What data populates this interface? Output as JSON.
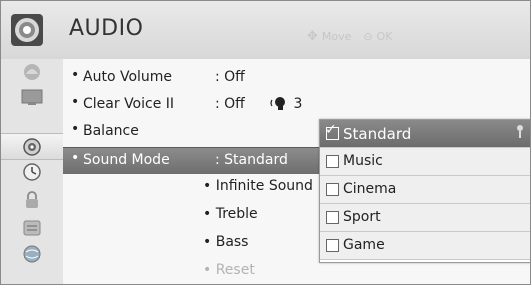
{
  "header": {
    "title": "AUDIO",
    "hint_move": "Move",
    "hint_ok": "OK",
    "icon": "speaker-disc-icon"
  },
  "sidebar": {
    "items": [
      {
        "name": "picture-icon",
        "active": false
      },
      {
        "name": "display-icon",
        "active": false
      },
      {
        "name": "audio-icon",
        "active": true
      },
      {
        "name": "clock-icon",
        "active": false
      },
      {
        "name": "lock-icon",
        "active": false
      },
      {
        "name": "option-icon",
        "active": false
      },
      {
        "name": "network-icon",
        "active": false
      }
    ]
  },
  "menu": {
    "rows": [
      {
        "label": "Auto Volume",
        "value": ": Off"
      },
      {
        "label": "Clear Voice II",
        "value": ": Off",
        "extra": "3"
      },
      {
        "label": "Balance",
        "value": ""
      },
      {
        "label": "Sound Mode",
        "value": ": Standard"
      }
    ],
    "subitems": [
      {
        "label": "• Infinite Sound"
      },
      {
        "label": "• Treble"
      },
      {
        "label": "• Bass"
      },
      {
        "label": "• Reset"
      }
    ]
  },
  "popup": {
    "options": [
      {
        "label": "Standard",
        "checked": true
      },
      {
        "label": "Music",
        "checked": false
      },
      {
        "label": "Cinema",
        "checked": false
      },
      {
        "label": "Sport",
        "checked": false
      },
      {
        "label": "Game",
        "checked": false
      }
    ]
  },
  "colors": {
    "selected_bg": "#7a7a7a",
    "panel_bg": "#f7f7f7",
    "sidebar_bg": "#e4e4e4"
  }
}
